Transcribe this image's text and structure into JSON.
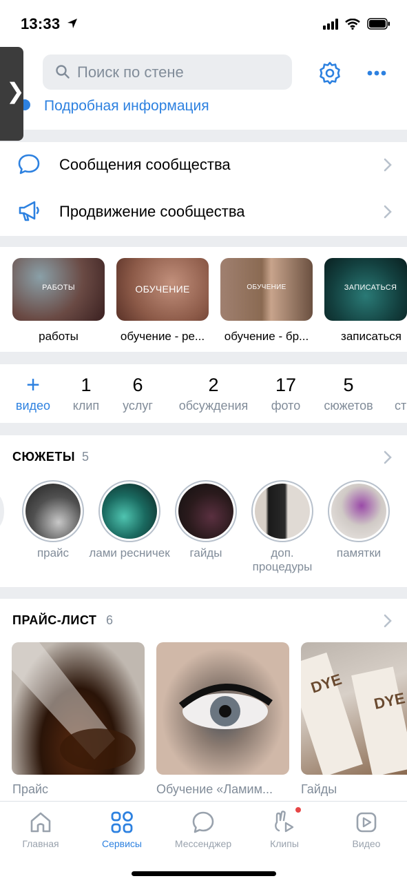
{
  "status_bar": {
    "time": "13:33"
  },
  "header": {
    "search_placeholder": "Поиск по стене",
    "info_link": "Подробная информация"
  },
  "menu": [
    {
      "label": "Сообщения сообщества",
      "icon": "message-bubble-icon"
    },
    {
      "label": "Продвижение сообщества",
      "icon": "megaphone-icon"
    }
  ],
  "covers": [
    {
      "title": "РАБОТЫ",
      "caption": "работы"
    },
    {
      "title": "ОБУЧЕНИЕ",
      "caption": "обучение - ре..."
    },
    {
      "title": "ОБУЧЕНИЕ",
      "caption": "обучение - бр..."
    },
    {
      "title": "ЗАПИСАТЬСЯ",
      "caption": "записаться"
    }
  ],
  "counters": [
    {
      "num": "+",
      "label": "видео"
    },
    {
      "num": "1",
      "label": "клип"
    },
    {
      "num": "6",
      "label": "услуг"
    },
    {
      "num": "2",
      "label": "обсуждения"
    },
    {
      "num": "17",
      "label": "фото"
    },
    {
      "num": "5",
      "label": "сюжетов"
    },
    {
      "num": "",
      "label": "ст"
    }
  ],
  "stories": {
    "title": "СЮЖЕТЫ",
    "count": "5",
    "items": [
      {
        "label": "прайс"
      },
      {
        "label": "лами ресничек"
      },
      {
        "label": "гайды"
      },
      {
        "label": "доп. процедуры"
      },
      {
        "label": "памятки"
      }
    ]
  },
  "price_list": {
    "title": "ПРАЙС-ЛИСТ",
    "count": "6",
    "items": [
      {
        "caption": "Прайс"
      },
      {
        "caption": "Обучение «Ламим..."
      },
      {
        "caption": "Гайды"
      }
    ],
    "product_text": {
      "dye": "DYE",
      "dye2": "DYE"
    }
  },
  "tabbar": [
    {
      "label": "Главная",
      "icon": "home-icon"
    },
    {
      "label": "Сервисы",
      "icon": "services-grid-icon"
    },
    {
      "label": "Мессенджер",
      "icon": "messenger-icon"
    },
    {
      "label": "Клипы",
      "icon": "clips-icon"
    },
    {
      "label": "Видео",
      "icon": "video-icon"
    }
  ],
  "colors": {
    "accent": "#2d81e0",
    "secondary_text": "#818c99",
    "background": "#ebedf0",
    "badge": "#e64646"
  }
}
